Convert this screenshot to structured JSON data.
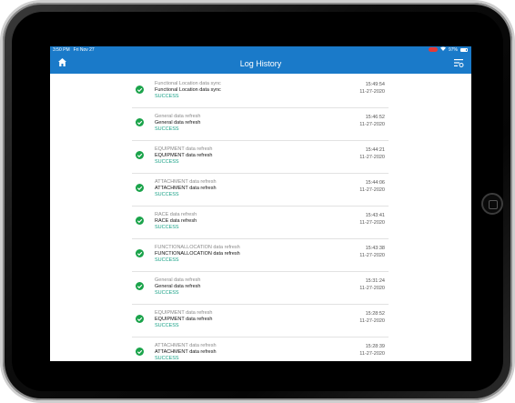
{
  "status_bar": {
    "time": "3:50 PM",
    "date": "Fri Nov 27",
    "battery": "97%"
  },
  "header": {
    "title": "Log History"
  },
  "colors": {
    "accent": "#1a7ac9",
    "success": "#16a085",
    "check": "#1aa34a"
  },
  "logs": [
    {
      "name": "Functional Location data sync",
      "description": "Functional Location data sync",
      "status": "SUCCESS",
      "time": "15:49:54",
      "date": "11-27-2020"
    },
    {
      "name": "General data refresh",
      "description": "General data refresh",
      "status": "SUCCESS",
      "time": "15:46:52",
      "date": "11-27-2020"
    },
    {
      "name": "EQUIPMENT data refresh",
      "description": "EQUIPMENT data refresh",
      "status": "SUCCESS",
      "time": "15:44:21",
      "date": "11-27-2020"
    },
    {
      "name": "ATTACHMENT data refresh",
      "description": "ATTACHMENT data refresh",
      "status": "SUCCESS",
      "time": "15:44:06",
      "date": "11-27-2020"
    },
    {
      "name": "RACE data refresh",
      "description": "RACE data refresh",
      "status": "SUCCESS",
      "time": "15:43:41",
      "date": "11-27-2020"
    },
    {
      "name": "FUNCTIONALLOCATION data refresh",
      "description": "FUNCTIONALLOCATION data refresh",
      "status": "SUCCESS",
      "time": "15:43:38",
      "date": "11-27-2020"
    },
    {
      "name": "General data refresh",
      "description": "General data refresh",
      "status": "SUCCESS",
      "time": "15:31:24",
      "date": "11-27-2020"
    },
    {
      "name": "EQUIPMENT data refresh",
      "description": "EQUIPMENT data refresh",
      "status": "SUCCESS",
      "time": "15:28:52",
      "date": "11-27-2020"
    },
    {
      "name": "ATTACHMENT data refresh",
      "description": "ATTACHMENT data refresh",
      "status": "SUCCESS",
      "time": "15:28:39",
      "date": "11-27-2020"
    }
  ]
}
